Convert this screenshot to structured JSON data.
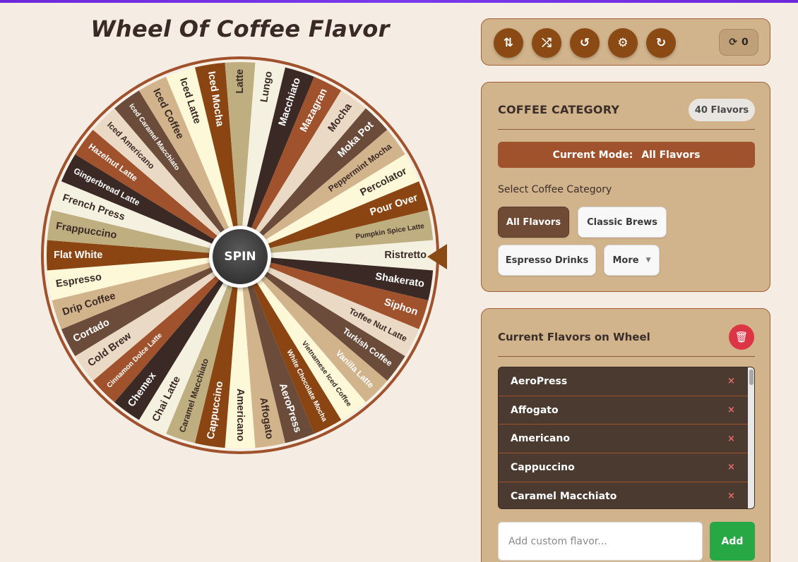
{
  "page": {
    "title": "Wheel Of Coffee Flavor"
  },
  "wheel": {
    "spin_label": "SPIN",
    "segments": [
      {
        "label": "Ristretto",
        "color": "#f5f1e0",
        "text_color": "#3a2a25"
      },
      {
        "label": "Shakerato",
        "color": "#3a2925",
        "text_color": "#ffffff"
      },
      {
        "label": "Siphon",
        "color": "#a0522d",
        "text_color": "#ffffff"
      },
      {
        "label": "Toffee Nut Latte",
        "color": "#ead9c4",
        "text_color": "#3a2a25"
      },
      {
        "label": "Turkish Coffee",
        "color": "#6b4c3a",
        "text_color": "#ffffff"
      },
      {
        "label": "Vanilla Latte",
        "color": "#d2b48c",
        "text_color": "#ffffff"
      },
      {
        "label": "Vietnamese Iced Coffee",
        "color": "#fdf8d8",
        "text_color": "#3a2a25"
      },
      {
        "label": "White Chocolate Mocha",
        "color": "#8b4513",
        "text_color": "#ffffff"
      },
      {
        "label": "AeroPress",
        "color": "#6b4c3a",
        "text_color": "#ffffff"
      },
      {
        "label": "Affogato",
        "color": "#d2b48c",
        "text_color": "#3a2a25"
      },
      {
        "label": "Americano",
        "color": "#fdf8d8",
        "text_color": "#3a2a25"
      },
      {
        "label": "Cappuccino",
        "color": "#8b4513",
        "text_color": "#ffffff"
      },
      {
        "label": "Caramel Macchiato",
        "color": "#bfae80",
        "text_color": "#3a2a25"
      },
      {
        "label": "Chai Latte",
        "color": "#f5f1e0",
        "text_color": "#3a2a25"
      },
      {
        "label": "Chemex",
        "color": "#3a2925",
        "text_color": "#ffffff"
      },
      {
        "label": "Cinnamon Dolce Latte",
        "color": "#a0522d",
        "text_color": "#ffffff"
      },
      {
        "label": "Cold Brew",
        "color": "#ead9c4",
        "text_color": "#3a2a25"
      },
      {
        "label": "Cortado",
        "color": "#6b4c3a",
        "text_color": "#ffffff"
      },
      {
        "label": "Drip Coffee",
        "color": "#d2b48c",
        "text_color": "#3a2a25"
      },
      {
        "label": "Espresso",
        "color": "#fdf8d8",
        "text_color": "#3a2a25"
      },
      {
        "label": "Flat White",
        "color": "#8b4513",
        "text_color": "#ffffff"
      },
      {
        "label": "Frappuccino",
        "color": "#bfae80",
        "text_color": "#3a2a25"
      },
      {
        "label": "French Press",
        "color": "#f5f1e0",
        "text_color": "#3a2a25"
      },
      {
        "label": "Gingerbread Latte",
        "color": "#3a2925",
        "text_color": "#ffffff"
      },
      {
        "label": "Hazelnut Latte",
        "color": "#a0522d",
        "text_color": "#ffffff"
      },
      {
        "label": "Iced Americano",
        "color": "#ead9c4",
        "text_color": "#3a2a25"
      },
      {
        "label": "Iced Caramel Macchiato",
        "color": "#6b4c3a",
        "text_color": "#ffffff"
      },
      {
        "label": "Iced Coffee",
        "color": "#d2b48c",
        "text_color": "#3a2a25"
      },
      {
        "label": "Iced Latte",
        "color": "#fdf8d8",
        "text_color": "#3a2a25"
      },
      {
        "label": "Iced Mocha",
        "color": "#8b4513",
        "text_color": "#ffffff"
      },
      {
        "label": "Latte",
        "color": "#bfae80",
        "text_color": "#3a2a25"
      },
      {
        "label": "Lungo",
        "color": "#f5f1e0",
        "text_color": "#3a2a25"
      },
      {
        "label": "Macchiato",
        "color": "#3a2925",
        "text_color": "#ffffff"
      },
      {
        "label": "Mazagran",
        "color": "#a0522d",
        "text_color": "#ffffff"
      },
      {
        "label": "Mocha",
        "color": "#ead9c4",
        "text_color": "#3a2a25"
      },
      {
        "label": "Moka Pot",
        "color": "#6b4c3a",
        "text_color": "#ffffff"
      },
      {
        "label": "Peppermint Mocha",
        "color": "#d2b48c",
        "text_color": "#3a2a25"
      },
      {
        "label": "Percolator",
        "color": "#fdf8d8",
        "text_color": "#3a2a25"
      },
      {
        "label": "Pour Over",
        "color": "#8b4513",
        "text_color": "#ffffff"
      },
      {
        "label": "Pumpkin Spice Latte",
        "color": "#bfae80",
        "text_color": "#3a2a25"
      }
    ]
  },
  "toolbar": {
    "icons": [
      "sort-icon",
      "shuffle-icon",
      "history-icon",
      "settings-icon",
      "reset-icon"
    ],
    "spin_count": "0"
  },
  "category": {
    "heading": "COFFEE CATEGORY",
    "count_badge": "40 Flavors",
    "mode_label": "Current Mode:",
    "mode_value": "All Flavors",
    "select_label": "Select Coffee Category",
    "buttons": {
      "all": "All Flavors",
      "classic": "Classic Brews",
      "espresso": "Espresso Drinks",
      "more": "More"
    }
  },
  "flavors_panel": {
    "heading": "Current Flavors on Wheel",
    "items": [
      "AeroPress",
      "Affogato",
      "Americano",
      "Cappuccino",
      "Caramel Macchiato"
    ],
    "remove_glyph": "×",
    "add_placeholder": "Add custom flavor...",
    "add_label": "Add"
  },
  "colors": {
    "accent": "#8b4a14",
    "panel": "#d2b48c",
    "danger": "#dc3545",
    "success": "#28a745"
  }
}
